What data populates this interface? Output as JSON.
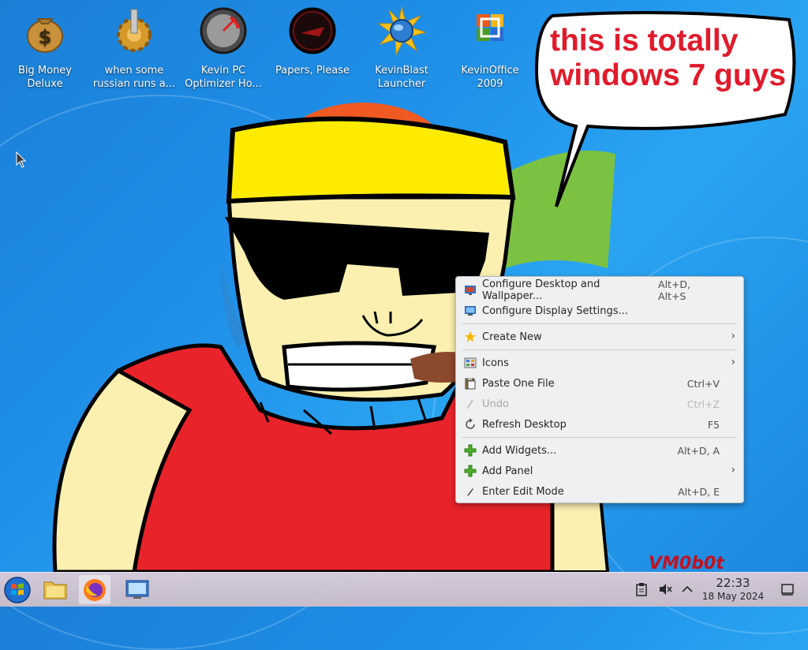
{
  "desktop_icons": [
    {
      "label": "Big Money Deluxe",
      "icon": "money-bag-icon"
    },
    {
      "label": "when some russian runs a...",
      "icon": "gear-icon"
    },
    {
      "label": "Kevin PC Optimizer Ho...",
      "icon": "gauge-icon"
    },
    {
      "label": "Papers, Please",
      "icon": "papers-please-icon"
    },
    {
      "label": "KevinBlast Launcher",
      "icon": "starburst-globe-icon"
    },
    {
      "label": "KevinOffice 2009",
      "icon": "office-logo-icon"
    }
  ],
  "bubble": {
    "line1": "this is totally",
    "line2": "windows 7 guys"
  },
  "signature": "VM0b0t",
  "context_menu": {
    "items": [
      {
        "label": "Configure Desktop and Wallpaper...",
        "shortcut": "Alt+D, Alt+S",
        "icon": "desktop-settings-icon"
      },
      {
        "label": "Configure Display Settings...",
        "shortcut": "",
        "icon": "display-icon"
      },
      {
        "label": "Create New",
        "shortcut": "",
        "icon": "new-item-icon",
        "submenu": true
      },
      {
        "label": "Icons",
        "shortcut": "",
        "icon": "icons-grid-icon",
        "submenu": true
      },
      {
        "label": "Paste One File",
        "shortcut": "Ctrl+V",
        "icon": "paste-icon"
      },
      {
        "label": "Undo",
        "shortcut": "Ctrl+Z",
        "icon": "undo-icon",
        "disabled": true
      },
      {
        "label": "Refresh Desktop",
        "shortcut": "F5",
        "icon": "refresh-icon"
      },
      {
        "label": "Add Widgets...",
        "shortcut": "Alt+D, A",
        "icon": "add-icon"
      },
      {
        "label": "Add Panel",
        "shortcut": "",
        "icon": "add-icon",
        "submenu": true
      },
      {
        "label": "Enter Edit Mode",
        "shortcut": "Alt+D, E",
        "icon": "edit-icon"
      }
    ],
    "submenu_arrow": "›"
  },
  "taskbar": {
    "clock_time": "22:33",
    "clock_date": "18 May 2024",
    "tray_expand": "^"
  },
  "colors": {
    "accent": "#e01b2b",
    "menu_bg": "#eff0f1"
  }
}
